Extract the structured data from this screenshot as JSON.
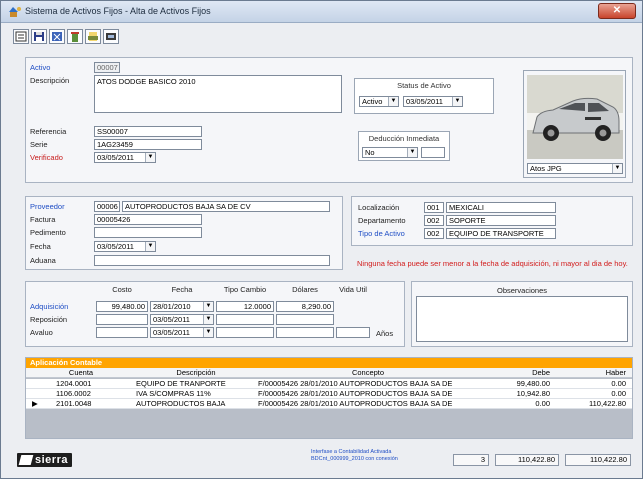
{
  "window": {
    "title": "Sistema de Activos Fijos - Alta de Activos Fijos"
  },
  "activo": {
    "activo_label": "Activo",
    "activo_value": "00007",
    "descripcion_label": "Descripción",
    "descripcion_value": "ATOS DODGE BASICO 2010",
    "referencia_label": "Referencia",
    "referencia_value": "SS00007",
    "serie_label": "Serie",
    "serie_value": "1AG23459",
    "verificado_label": "Verificado",
    "verificado_value": "03/05/2011"
  },
  "status": {
    "title": "Status de Activo",
    "status_value": "Activo",
    "date_value": "03/05/2011"
  },
  "deduccion": {
    "title": "Deducción Inmediata",
    "value": "No",
    "extra": ""
  },
  "photo": {
    "file": "Atos JPG"
  },
  "proveedor": {
    "proveedor_label": "Proveedor",
    "proveedor_code": "00006",
    "proveedor_name": "AUTOPRODUCTOS BAJA SA DE CV",
    "factura_label": "Factura",
    "factura_value": "00005426",
    "pedimento_label": "Pedimento",
    "pedimento_value": "",
    "fecha_label": "Fecha",
    "fecha_value": "03/05/2011",
    "aduana_label": "Aduana",
    "aduana_value": ""
  },
  "localizacion": {
    "loc_label": "Localización",
    "loc_code": "001",
    "loc_name": "MEXICALI",
    "dep_label": "Departamento",
    "dep_code": "002",
    "dep_name": "SOPORTE",
    "tipo_label": "Tipo de Activo",
    "tipo_code": "002",
    "tipo_name": "EQUIPO DE TRANSPORTE"
  },
  "warning": "Ninguna fecha puede ser menor a la fecha de adquisición, ni mayor al dia de hoy.",
  "costos": {
    "headers": [
      "Costo",
      "Fecha",
      "Tipo Cambio",
      "Dólares",
      "Vida Util"
    ],
    "adq_label": "Adquisición",
    "adq_costo": "99,480.00",
    "adq_fecha": "28/01/2010",
    "adq_tc": "12.0000",
    "adq_dolares": "8,290.00",
    "rep_label": "Reposición",
    "rep_fecha": "03/05/2011",
    "ava_label": "Avaluo",
    "ava_fecha": "03/05/2011",
    "anos": "Años"
  },
  "observaciones": {
    "title": "Observaciones"
  },
  "contable": {
    "title": "Aplicación Contable",
    "headers": [
      "Cuenta",
      "Descripción",
      "Concepto",
      "Debe",
      "Haber"
    ],
    "rows": [
      {
        "cuenta": "1204.0001",
        "desc": "EQUIPO DE TRANPORTE",
        "concepto": "F/00005426  28/01/2010  AUTOPRODUCTOS BAJA SA DE",
        "debe": "99,480.00",
        "haber": "0.00"
      },
      {
        "cuenta": "1106.0002",
        "desc": "IVA S/COMPRAS 11%",
        "concepto": "F/00005426  28/01/2010  AUTOPRODUCTOS BAJA SA DE",
        "debe": "10,942.80",
        "haber": "0.00"
      },
      {
        "cuenta": "2101.0048",
        "desc": "AUTOPRODUCTOS BAJA",
        "concepto": "F/00005426  28/01/2010  AUTOPRODUCTOS BAJA SA DE",
        "debe": "0.00",
        "haber": "110,422.80"
      }
    ]
  },
  "footer": {
    "logo": "sierra",
    "interface_line1": "Interfase a Contabilidad Activada",
    "interface_line2": "BDCnt_000999_2010 con conexión",
    "count": "3",
    "total_debe": "110,422.80",
    "total_haber": "110,422.80"
  },
  "colors": {
    "accent_orange": "#ffa400",
    "link_blue": "#1f4ec5",
    "warning_red": "#d21c1c"
  }
}
